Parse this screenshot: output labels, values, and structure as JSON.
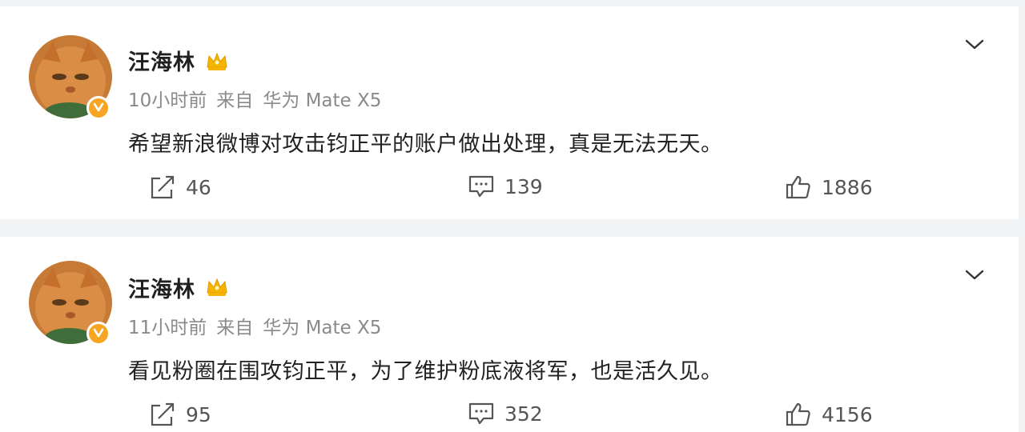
{
  "posts": [
    {
      "username": "汪海林",
      "time": "10小时前",
      "source_prefix": "来自",
      "device": "华为 Mate X5",
      "content": "希望新浪微博对攻击钧正平的账户做出处理，真是无法无天。",
      "reposts": "46",
      "comments": "139",
      "likes": "1886"
    },
    {
      "username": "汪海林",
      "time": "11小时前",
      "source_prefix": "来自",
      "device": "华为 Mate X5",
      "content": "看见粉圈在围攻钧正平，为了维护粉底液将军，也是活久见。",
      "reposts": "95",
      "comments": "352",
      "likes": "4156"
    }
  ],
  "icons": {
    "avatar": "cat-avatar-icon",
    "verified": "verified-badge-icon",
    "crown": "vip-crown-icon",
    "menu": "chevron-down-icon",
    "repost": "repost-icon",
    "comment": "comment-icon",
    "like": "thumbs-up-icon"
  },
  "colors": {
    "verified_badge": "#f6a623",
    "crown": "#f5b400",
    "meta_text": "#8a8a8a"
  }
}
